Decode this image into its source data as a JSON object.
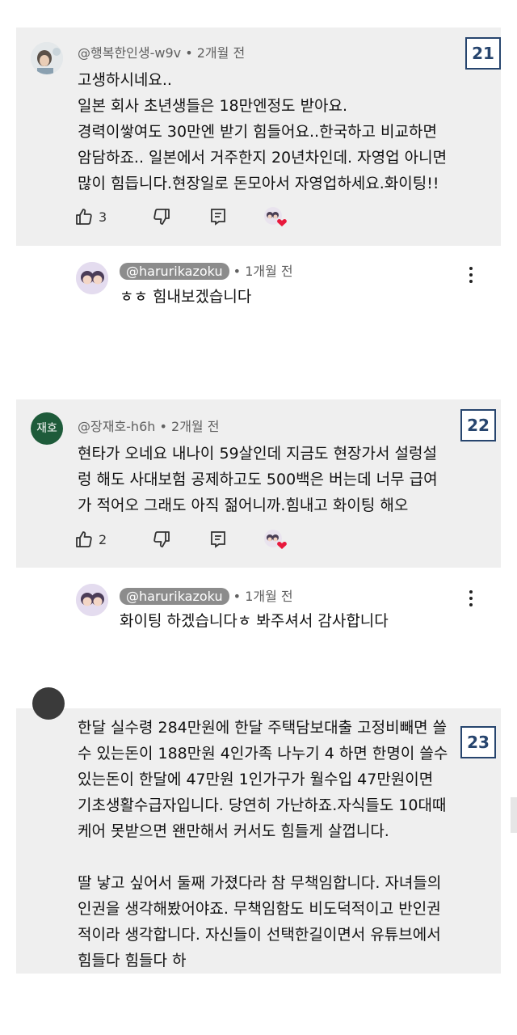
{
  "comments": [
    {
      "handle": "@행복한인생-w9v",
      "time": "2개월 전",
      "number": "21",
      "text": "고생하시네요..\n일본 회사 초년생들은 18만엔정도 받아요.\n경력이쌓여도 30만엔 받기 힘들어요..한국하고 비교하면\n암담하죠.. 일본에서 거주한지 20년차인데. 자영업 아니면\n많이 힘듭니다.현장일로  돈모아서 자영업하세요.화이팅!!",
      "likes": "3",
      "reply": {
        "handle": "@harurikazoku",
        "time": "1개월 전",
        "text": "ㅎㅎ 힘내보겠습니다"
      }
    },
    {
      "handle": "@장재호-h6h",
      "avatar_text": "재호",
      "time": "2개월 전",
      "number": "22",
      "text": "현타가 오네요 내나이 59살인데 지금도 현장가서 설렁설\n렁 해도  사대보험 공제하고도 500백은 버는데 너무 급여\n가  적어오  그래도 아직 젊어니까.힘내고 화이팅 해오",
      "likes": "2",
      "reply": {
        "handle": "@harurikazoku",
        "time": "1개월 전",
        "text": "화이팅 하겠습니다ㅎ 봐주셔서 감사합니다"
      }
    },
    {
      "number": "23",
      "text": "한달 실수령 284만원에 한달 주택담보대출 고정비빼면 쓸\n수 있는돈이 188만원 4인가족 나누기 4 하면 한명이 쓸수\n있는돈이 한달에 47만원  1인가구가 월수입 47만원이면\n기초생활수급자입니다. 당연히 가난하죠.자식들도 10대때\n케어 못받으면 왠만해서 커서도 힘들게 살껍니다.\n\n딸 낳고 싶어서 둘째 가졌다라 참 무책임합니다. 자녀들의\n인권을 생각해봤어야죠. 무책임함도 비도덕적이고 반인권\n적이라 생각합니다. 자신들이 선택한길이면서 유튜브에서\n힘들다 힘들다 하"
    }
  ],
  "colors": {
    "badge": "#27456e",
    "card": "#efefef",
    "avatar_green": "#1e5b3a"
  },
  "icons": [
    "thumb-up-icon",
    "thumb-down-icon",
    "reply-icon",
    "creator-heart-icon",
    "more-vert-icon"
  ]
}
